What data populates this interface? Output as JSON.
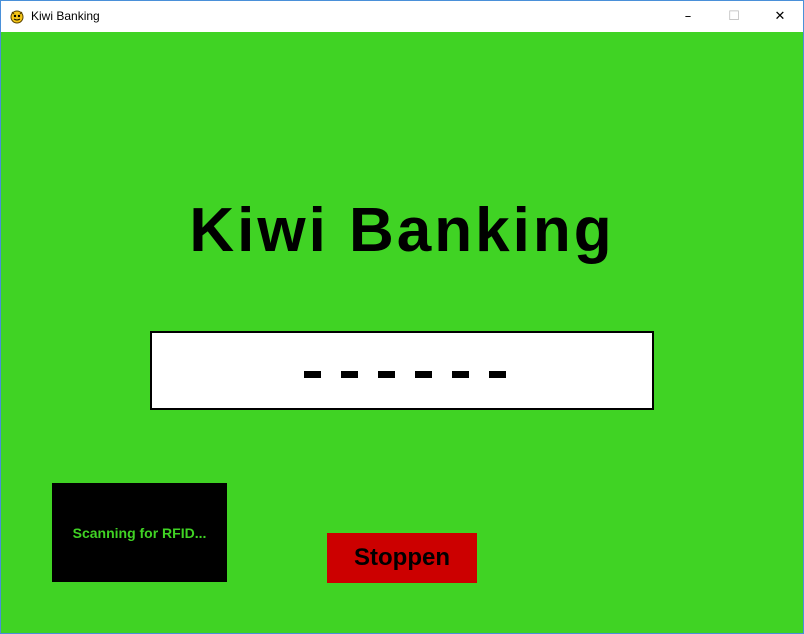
{
  "window": {
    "title": "Kiwi Banking",
    "icon": "pygame-snake-icon",
    "controls": {
      "minimize": "–",
      "maximize": "☐",
      "close": "✕"
    }
  },
  "main": {
    "heading": "Kiwi Banking",
    "pin_entered_count": 0,
    "pin_length": 6,
    "rfid_status": "Scanning for RFID...",
    "stop_button_label": "Stoppen"
  },
  "colors": {
    "background": "#40d324",
    "rfid_panel": "#000000",
    "rfid_text": "#40d324",
    "stop_button": "#cc0000"
  }
}
